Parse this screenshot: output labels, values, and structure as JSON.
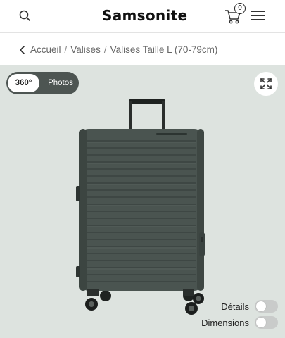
{
  "header": {
    "logo_text": "Samsonite",
    "cart_count": "0",
    "icons": {
      "search": "search-icon",
      "cart": "cart-icon",
      "menu": "hamburger-menu-icon"
    }
  },
  "breadcrumb": {
    "back_icon": "chevron-left-icon",
    "items": [
      {
        "label": "Accueil"
      },
      {
        "label": "Valises"
      },
      {
        "label": "Valises Taille L (70-79cm)"
      }
    ],
    "separator": "/"
  },
  "viewer": {
    "background_color": "#dde3df",
    "view_toggle": {
      "active": "360°",
      "inactive": "Photos"
    },
    "fullscreen_icon": "expand-icon",
    "product_color": "#4a5450",
    "switches": [
      {
        "label": "Détails",
        "on": false
      },
      {
        "label": "Dimensions",
        "on": false
      }
    ]
  }
}
